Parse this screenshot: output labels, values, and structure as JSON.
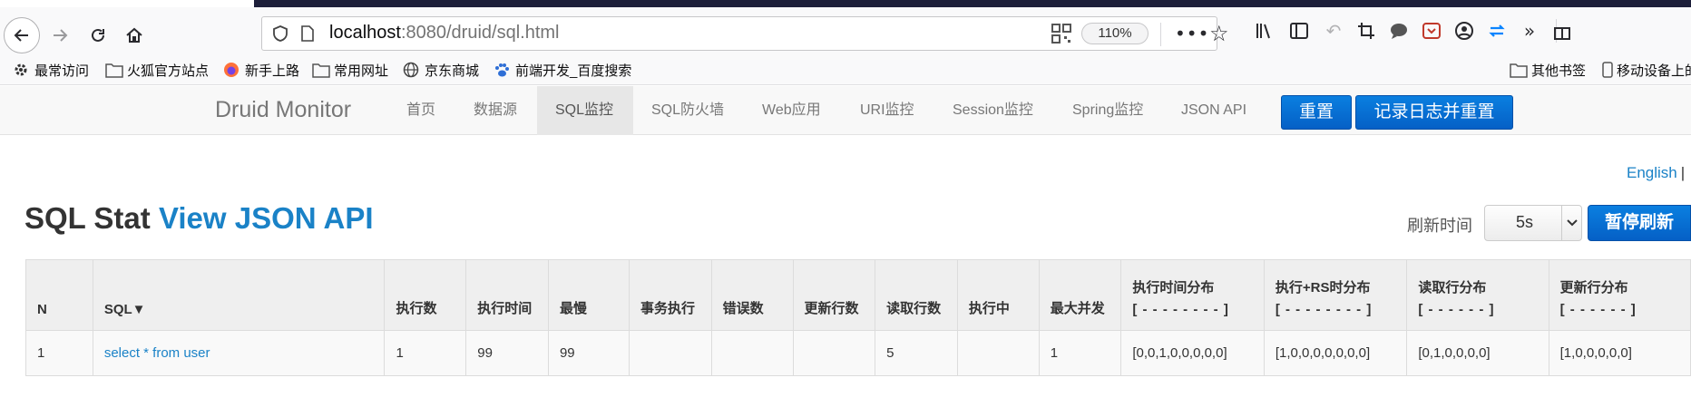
{
  "browser": {
    "url_host": "localhost",
    "url_rest": ":8080/druid/sql.html",
    "zoom": "110%"
  },
  "bookmarks": [
    {
      "label": "最常访问",
      "icon": "gear-icon"
    },
    {
      "label": "火狐官方站点",
      "icon": "folder-icon"
    },
    {
      "label": "新手上路",
      "icon": "firefox-icon"
    },
    {
      "label": "常用网址",
      "icon": "folder-icon"
    },
    {
      "label": "京东商城",
      "icon": "globe-icon"
    },
    {
      "label": "前端开发_百度搜索",
      "icon": "baidu-paw-icon"
    }
  ],
  "bookmarks_right": [
    {
      "label": "其他书签",
      "icon": "folder-icon"
    },
    {
      "label": "移动设备上的",
      "icon": "mobile-icon"
    }
  ],
  "druid_nav": {
    "brand": "Druid Monitor",
    "items": [
      "首页",
      "数据源",
      "SQL监控",
      "SQL防火墙",
      "Web应用",
      "URI监控",
      "Session监控",
      "Spring监控",
      "JSON API"
    ],
    "active_index": 2,
    "reset_label": "重置",
    "log_reset_label": "记录日志并重置"
  },
  "lang": {
    "english": "English",
    "sep": "|"
  },
  "page": {
    "title": "SQL Stat",
    "title_link": "View JSON API",
    "refresh_label": "刷新时间",
    "refresh_value": "5s",
    "pause_label": "暂停刷新"
  },
  "table": {
    "headers": [
      {
        "label": "N"
      },
      {
        "label": "SQL▼"
      },
      {
        "label": "执行数"
      },
      {
        "label": "执行时间"
      },
      {
        "label": "最慢"
      },
      {
        "label": "事务执行"
      },
      {
        "label": "错误数"
      },
      {
        "label": "更新行数"
      },
      {
        "label": "读取行数"
      },
      {
        "label": "执行中"
      },
      {
        "label": "最大并发"
      },
      {
        "label": "执行时间分布",
        "sub": "[ - - - - - - - - ]"
      },
      {
        "label": "执行+RS时分布",
        "sub": "[ - - - - - - - - ]"
      },
      {
        "label": "读取行分布",
        "sub": "[ - - - - - - ]"
      },
      {
        "label": "更新行分布",
        "sub": "[ - - - - - - ]"
      }
    ],
    "rows": [
      [
        "1",
        "select * from user",
        "1",
        "99",
        "99",
        "",
        "",
        "",
        "5",
        "",
        "1",
        "[0,0,1,0,0,0,0,0]",
        "[1,0,0,0,0,0,0,0]",
        "[0,1,0,0,0,0]",
        "[1,0,0,0,0,0]"
      ]
    ]
  }
}
